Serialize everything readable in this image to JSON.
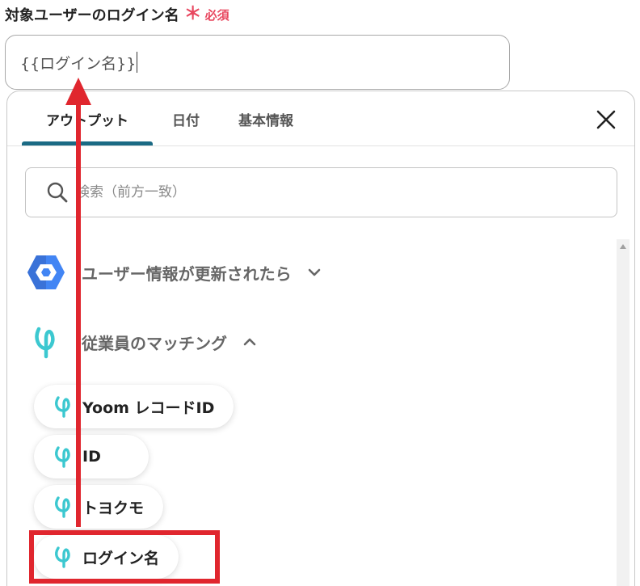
{
  "field": {
    "label": "対象ユーザーのログイン名",
    "required_mark": "＊",
    "required_text": "必須",
    "value": "{{ログイン名}}"
  },
  "tabs": [
    {
      "label": "アウトプット",
      "active": true
    },
    {
      "label": "日付",
      "active": false
    },
    {
      "label": "基本情報",
      "active": false
    }
  ],
  "search": {
    "placeholder": "検索（前方一致）"
  },
  "groups": [
    {
      "label": "ユーザー情報が更新されたら",
      "icon": "google-workspace-icon",
      "expanded": false
    },
    {
      "label": "従業員のマッチング",
      "icon": "yoom-icon",
      "expanded": true
    }
  ],
  "items": [
    {
      "label": "Yoom レコードID"
    },
    {
      "label": "ID"
    },
    {
      "label": "トヨクモ"
    },
    {
      "label": "ログイン名"
    }
  ],
  "colors": {
    "accent": "#1a6a84",
    "required": "#e8475f",
    "annotation": "#e0262e",
    "yoom": "#3cc8d0"
  }
}
